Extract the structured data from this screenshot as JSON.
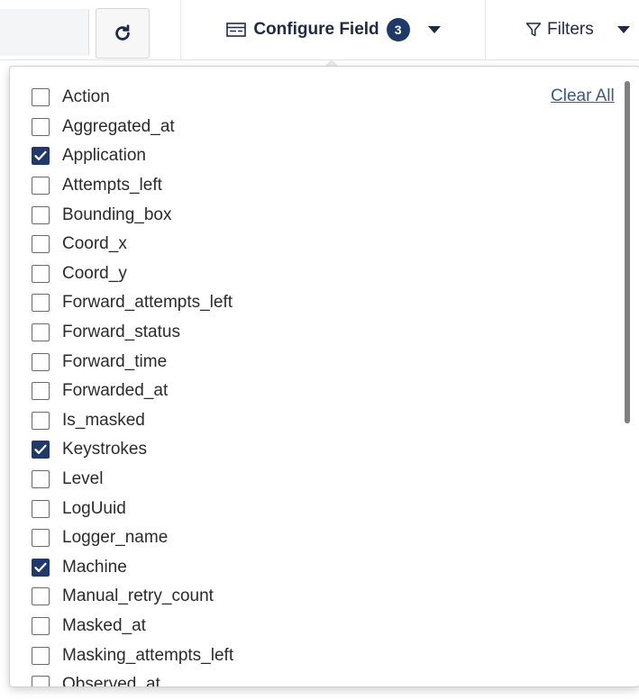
{
  "toolbar": {
    "configure_label": "Configure Field",
    "configure_count": "3",
    "filters_label": "Filters"
  },
  "panel": {
    "clear_all": "Clear All",
    "fields": [
      {
        "label": "Action",
        "checked": false
      },
      {
        "label": "Aggregated_at",
        "checked": false
      },
      {
        "label": "Application",
        "checked": true
      },
      {
        "label": "Attempts_left",
        "checked": false
      },
      {
        "label": "Bounding_box",
        "checked": false
      },
      {
        "label": "Coord_x",
        "checked": false
      },
      {
        "label": "Coord_y",
        "checked": false
      },
      {
        "label": "Forward_attempts_left",
        "checked": false
      },
      {
        "label": "Forward_status",
        "checked": false
      },
      {
        "label": "Forward_time",
        "checked": false
      },
      {
        "label": "Forwarded_at",
        "checked": false
      },
      {
        "label": "Is_masked",
        "checked": false
      },
      {
        "label": "Keystrokes",
        "checked": true
      },
      {
        "label": "Level",
        "checked": false
      },
      {
        "label": "LogUuid",
        "checked": false
      },
      {
        "label": "Logger_name",
        "checked": false
      },
      {
        "label": "Machine",
        "checked": true
      },
      {
        "label": "Manual_retry_count",
        "checked": false
      },
      {
        "label": "Masked_at",
        "checked": false
      },
      {
        "label": "Masking_attempts_left",
        "checked": false
      },
      {
        "label": "Observed_at",
        "checked": false
      }
    ]
  },
  "colors": {
    "accent": "#1f3a68",
    "link": "#3c5a7d"
  },
  "icons": {
    "refresh": "refresh-icon",
    "configure": "columns-icon",
    "filter": "filter-icon",
    "check": "checkmark-icon"
  }
}
